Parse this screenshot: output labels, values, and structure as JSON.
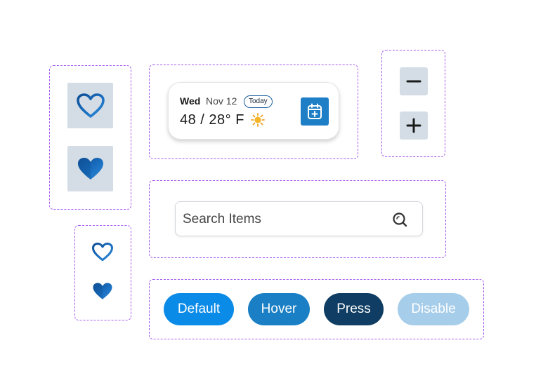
{
  "weather": {
    "day": "Wed",
    "date": "Nov 12",
    "badge": "Today",
    "temperature": "48 / 28° F",
    "condition_icon": "sun-icon",
    "action_icon": "calendar-add-icon"
  },
  "stepper": {
    "minus_icon": "minus-icon",
    "plus_icon": "plus-icon"
  },
  "favorites": {
    "outline_icon": "heart-outline-icon",
    "filled_icon": "heart-filled-icon"
  },
  "search": {
    "placeholder": "Search Items",
    "icon": "search-icon"
  },
  "buttons": {
    "default": "Default",
    "hover": "Hover",
    "press": "Press",
    "disable": "Disable"
  },
  "colors": {
    "outline_dash": "#a55bf0",
    "tile_bg": "#d4dde5",
    "btn_default": "#0a8be8",
    "btn_hover": "#1a7fc4",
    "btn_press": "#0f3d63",
    "btn_disable": "#a6cde9",
    "heart_blue": "#1e6fb8"
  }
}
